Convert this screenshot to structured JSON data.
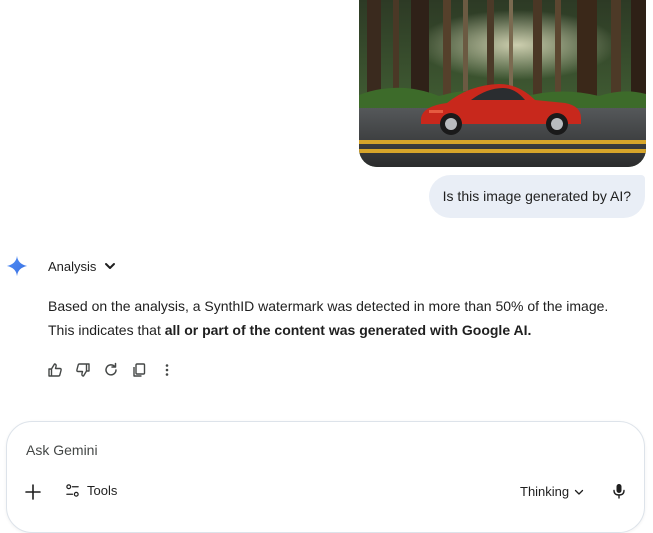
{
  "user_message": "Is this image generated by AI?",
  "response": {
    "header_label": "Analysis",
    "text_before": "Based on the analysis, a SynthID watermark was detected in more than 50% of the image. This indicates that ",
    "text_bold": "all or part of the content was generated with Google AI.",
    "actions": [
      "thumbs-up-icon",
      "thumbs-down-icon",
      "regenerate-icon",
      "copy-icon",
      "more-icon"
    ]
  },
  "composer": {
    "placeholder": "Ask Gemini",
    "tools_label": "Tools",
    "mode_label": "Thinking"
  },
  "colors": {
    "accent_blue": "#4285f4",
    "bubble_bg": "#e9eef6",
    "car_red": "#c8281c"
  }
}
